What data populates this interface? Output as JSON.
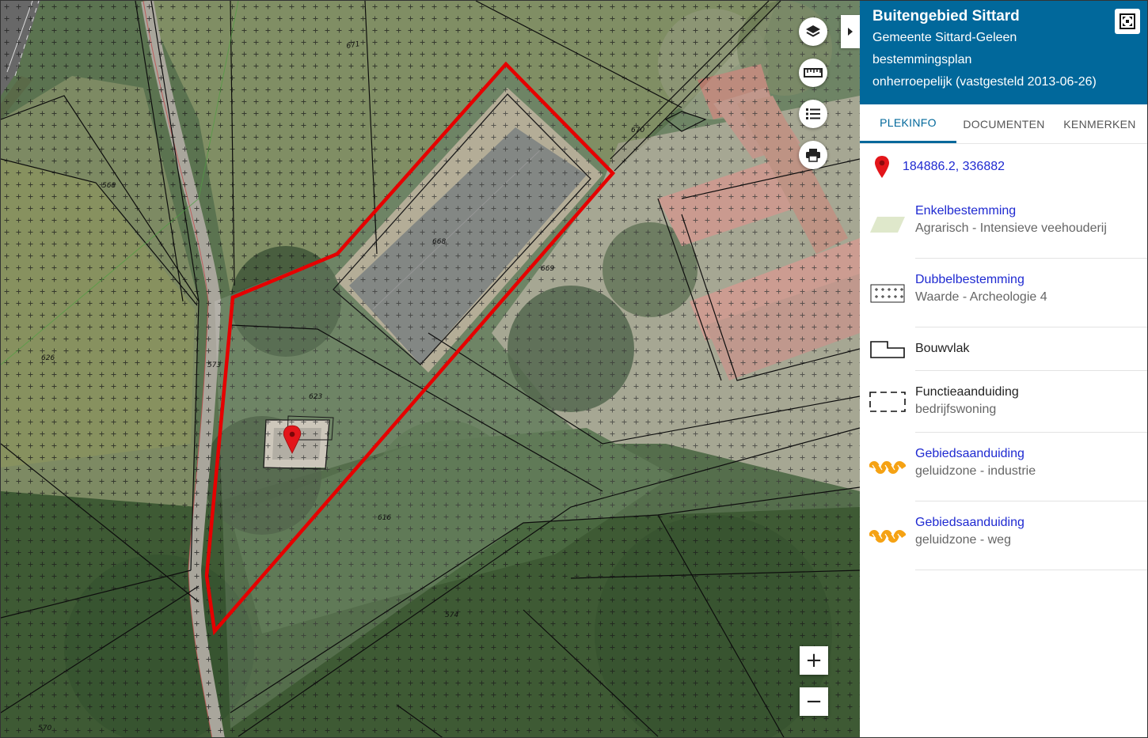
{
  "map": {
    "parcel_labels": [
      "671",
      "670",
      "568",
      "668",
      "669",
      "626",
      "573",
      "623",
      "616",
      "574",
      "570"
    ],
    "controls": {
      "layers_icon": "layers-icon",
      "measure_icon": "ruler-icon",
      "legend_icon": "list-icon",
      "print_icon": "printer-icon",
      "zoom_in": "+",
      "zoom_out": "−"
    },
    "colors": {
      "selection_outline": "#e60000",
      "marker": "#e3151a"
    }
  },
  "panel": {
    "title": "Buitengebied Sittard",
    "municipality": "Gemeente Sittard-Geleen",
    "plan_type": "bestemmingsplan",
    "status": "onherroepelijk (vastgesteld 2013-06-26)",
    "header_color": "#01689b",
    "tabs": [
      {
        "label": "PLEKINFO",
        "active": true
      },
      {
        "label": "DOCUMENTEN",
        "active": false
      },
      {
        "label": "KENMERKEN",
        "active": false
      }
    ],
    "coordinates": "184886.2, 336882",
    "legend": [
      {
        "title": "Enkelbestemming",
        "subtitle": "Agrarisch - Intensieve veehouderij",
        "symbol": "parallelogram-icon",
        "link": true
      },
      {
        "title": "Dubbelbestemming",
        "subtitle": "Waarde - Archeologie 4",
        "symbol": "plus-grid-icon",
        "link": true
      },
      {
        "title": "Bouwvlak",
        "subtitle": "",
        "symbol": "building-outline-icon",
        "link": false
      },
      {
        "title": "Functieaanduiding",
        "subtitle": "bedrijfswoning",
        "symbol": "dashed-rect-icon",
        "link": false
      },
      {
        "title": "Gebiedsaanduiding",
        "subtitle": "geluidzone - industrie",
        "symbol": "orange-zone-icon",
        "link": true
      },
      {
        "title": "Gebiedsaanduiding",
        "subtitle": "geluidzone - weg",
        "symbol": "orange-zone-icon",
        "link": true
      }
    ]
  }
}
